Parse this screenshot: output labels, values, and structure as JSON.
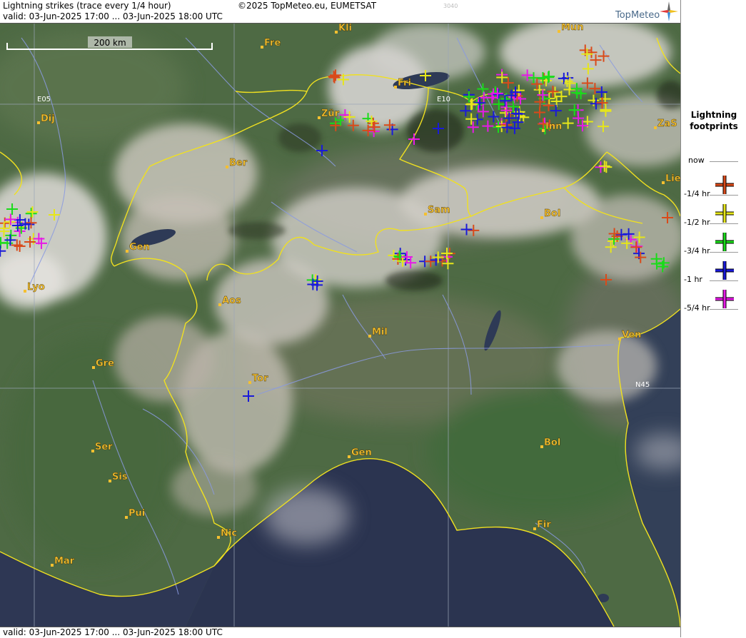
{
  "header": {
    "title": "Lightning strikes (trace every 1/4 hour)",
    "valid": "valid:  03-Jun-2025 17:00 ... 03-Jun-2025 18:00 UTC",
    "copyright": "©2025 TopMeteo.eu, EUMETSAT",
    "code": "3040",
    "brand": "TopMeteo"
  },
  "footer": {
    "valid": "valid:  03-Jun-2025 17:00 ... 03-Jun-2025 18:00 UTC"
  },
  "scale": {
    "label": "200 km"
  },
  "grid": {
    "lon1": "E05",
    "lon2": "E10",
    "lat1": "N45"
  },
  "cities": [
    {
      "label": "Kli",
      "key": "kli"
    },
    {
      "label": "Mun",
      "key": "mun"
    },
    {
      "label": "Fre",
      "key": "fre"
    },
    {
      "label": "Fri",
      "key": "fri"
    },
    {
      "label": "Dij",
      "key": "dij"
    },
    {
      "label": "Zür",
      "key": "zur"
    },
    {
      "label": "Inn",
      "key": "inn"
    },
    {
      "label": "ZaS",
      "key": "zas"
    },
    {
      "label": "Ber",
      "key": "ber"
    },
    {
      "label": "Lie",
      "key": "lie"
    },
    {
      "label": "Sam",
      "key": "sam"
    },
    {
      "label": "Bol",
      "key": "bol1"
    },
    {
      "label": "Gen",
      "key": "gen1"
    },
    {
      "label": "Lyo",
      "key": "lyo"
    },
    {
      "label": "Aos",
      "key": "aos"
    },
    {
      "label": "Mil",
      "key": "mil"
    },
    {
      "label": "Ven",
      "key": "ven"
    },
    {
      "label": "Gre",
      "key": "gre"
    },
    {
      "label": "Tor",
      "key": "tor"
    },
    {
      "label": "Bol",
      "key": "bol2"
    },
    {
      "label": "Gen",
      "key": "gen2"
    },
    {
      "label": "Ser",
      "key": "ser"
    },
    {
      "label": "Sis",
      "key": "sis"
    },
    {
      "label": "Pui",
      "key": "pui"
    },
    {
      "label": "Nic",
      "key": "nic"
    },
    {
      "label": "Fir",
      "key": "fir"
    },
    {
      "label": "Mar",
      "key": "mar"
    }
  ],
  "legend": {
    "title_line1": "Lightning",
    "title_line2": "footprints",
    "items": [
      {
        "label": "now",
        "color": ""
      },
      {
        "label": "-1/4 hr",
        "color": "#d94a1a"
      },
      {
        "label": "-1/2 hr",
        "color": "#e6e61a"
      },
      {
        "label": "-3/4 hr",
        "color": "#1adb1a"
      },
      {
        "label": "-1 hr",
        "color": "#1a1ad9"
      },
      {
        "label": "-5/4 hr",
        "color": "#e61ae6"
      }
    ]
  },
  "colors": {
    "quarter_1": "#d94a1a",
    "quarter_2": "#e6e61a",
    "quarter_3": "#1adb1a",
    "quarter_4": "#1a1ad9",
    "quarter_5": "#e61ae6",
    "border": "#f0e020",
    "city": "#f5c030"
  }
}
